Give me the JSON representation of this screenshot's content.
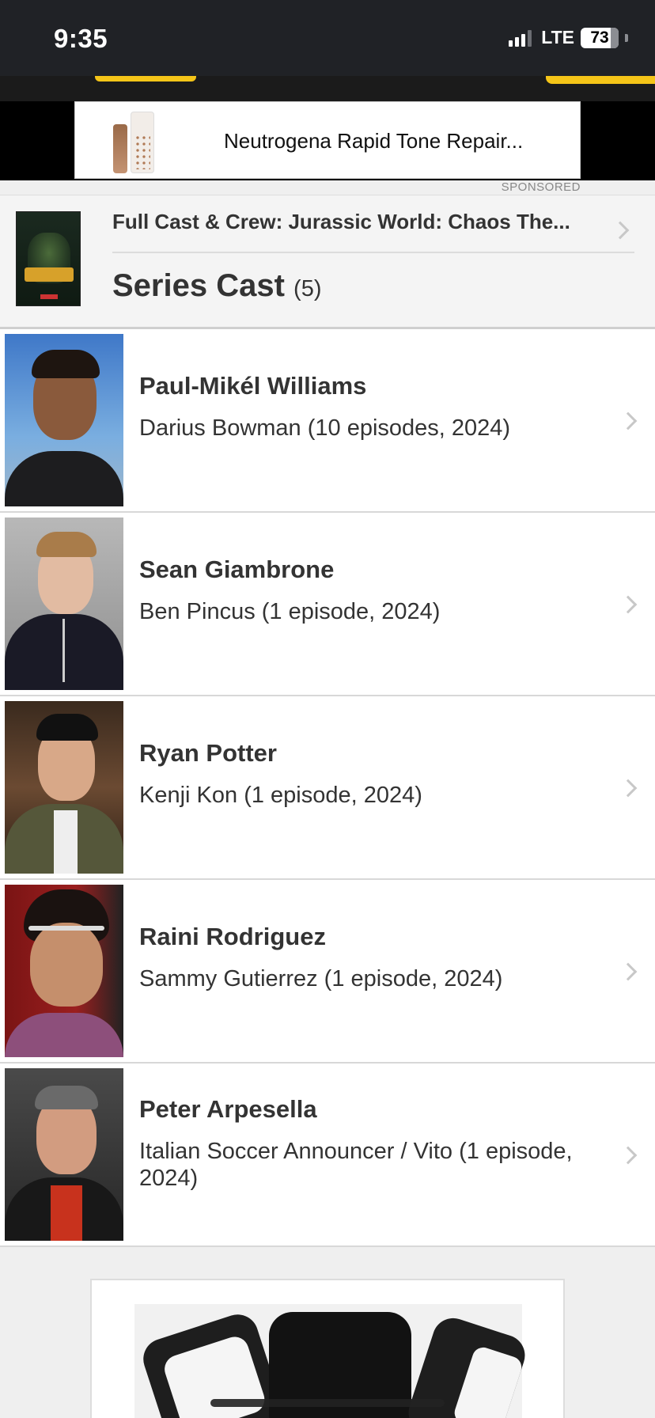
{
  "status_bar": {
    "time": "9:35",
    "network": "LTE",
    "battery": "73"
  },
  "ad_top": {
    "title": "Neutrogena Rapid Tone Repair...",
    "sponsored_label": "SPONSORED"
  },
  "header": {
    "title": "Full Cast & Crew: Jurassic World: Chaos The...",
    "section": "Series Cast",
    "count": "(5)"
  },
  "cast": [
    {
      "name": "Paul-Mikél Williams",
      "role": "Darius Bowman (10 episodes, 2024)"
    },
    {
      "name": "Sean Giambrone",
      "role": "Ben Pincus (1 episode, 2024)"
    },
    {
      "name": "Ryan Potter",
      "role": "Kenji Kon (1 episode, 2024)"
    },
    {
      "name": "Raini Rodriguez",
      "role": "Sammy Gutierrez (1 episode, 2024)"
    },
    {
      "name": "Peter Arpesella",
      "role": "Italian Soccer Announcer / Vito (1 episode, 2024)"
    }
  ],
  "colors": {
    "accent": "#f5c518",
    "status_bar_bg": "#202226"
  }
}
